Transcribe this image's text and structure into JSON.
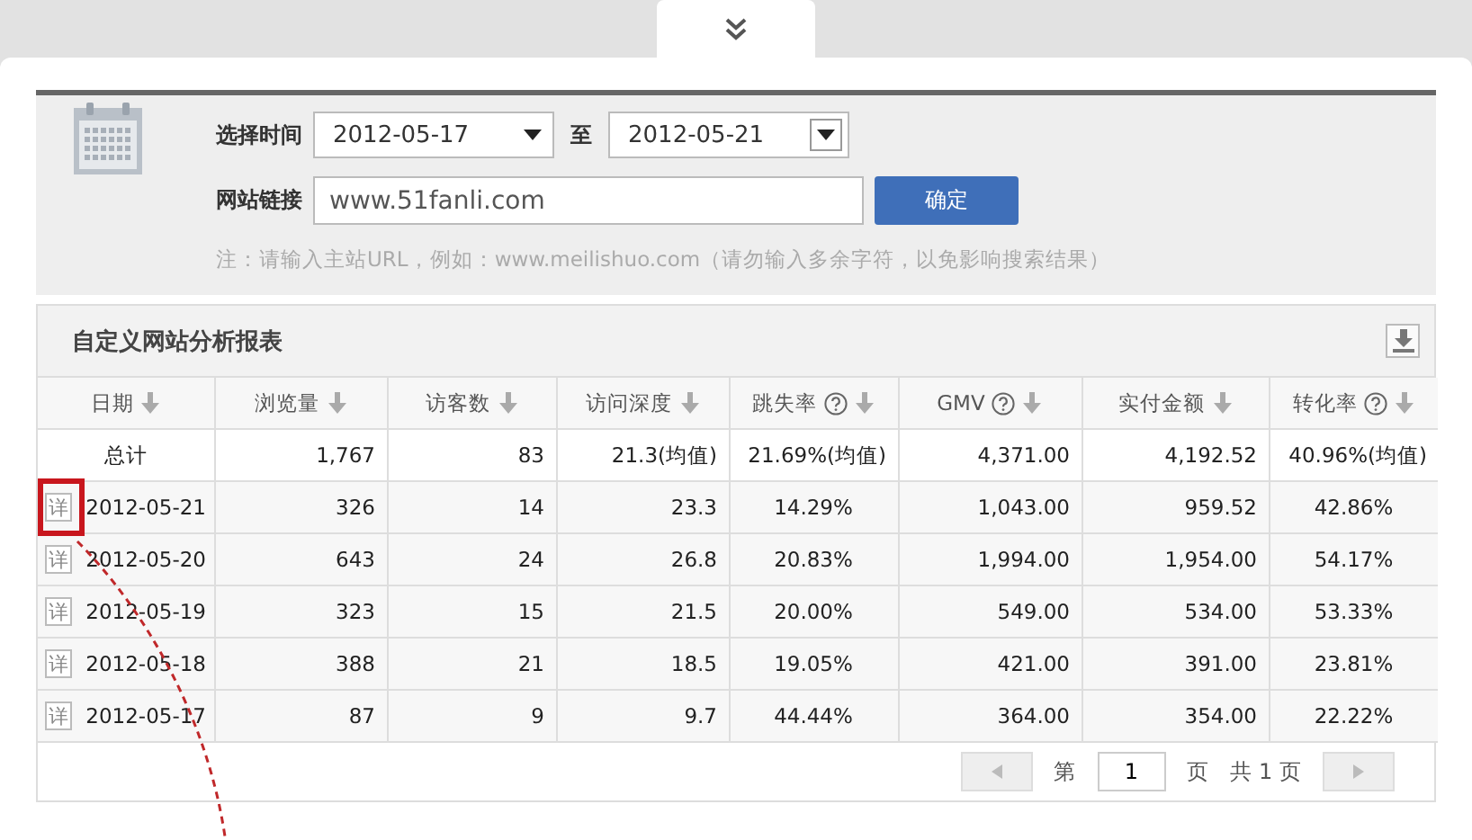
{
  "filter": {
    "time_label": "选择时间",
    "date_from": "2012-05-17",
    "separator": "至",
    "date_to": "2012-05-21",
    "url_label": "网站链接",
    "url_value": "www.51fanli.com",
    "submit": "确定",
    "note": "注：请输入主站URL，例如：www.meilishuo.com（请勿输入多余字符，以免影响搜索结果）"
  },
  "report": {
    "title": "自定义网站分析报表",
    "columns": [
      {
        "label": "日期",
        "help": false
      },
      {
        "label": "浏览量",
        "help": false
      },
      {
        "label": "访客数",
        "help": false
      },
      {
        "label": "访问深度",
        "help": false
      },
      {
        "label": "跳失率",
        "help": true
      },
      {
        "label": "GMV",
        "help": true
      },
      {
        "label": "实付金额",
        "help": false
      },
      {
        "label": "转化率",
        "help": true
      }
    ],
    "total": {
      "cells": [
        "总计",
        "1,767",
        "83",
        "21.3(均值)",
        "21.69%(均值)",
        "4,371.00",
        "4,192.52",
        "40.96%(均值)"
      ]
    },
    "rows": [
      {
        "detail": "详",
        "highlighted": true,
        "cells": [
          "2012-05-21",
          "326",
          "14",
          "23.3",
          "14.29%",
          "1,043.00",
          "959.52",
          "42.86%"
        ]
      },
      {
        "detail": "详",
        "highlighted": false,
        "cells": [
          "2012-05-20",
          "643",
          "24",
          "26.8",
          "20.83%",
          "1,994.00",
          "1,954.00",
          "54.17%"
        ]
      },
      {
        "detail": "详",
        "highlighted": false,
        "cells": [
          "2012-05-19",
          "323",
          "15",
          "21.5",
          "20.00%",
          "549.00",
          "534.00",
          "53.33%"
        ]
      },
      {
        "detail": "详",
        "highlighted": false,
        "cells": [
          "2012-05-18",
          "388",
          "21",
          "18.5",
          "19.05%",
          "421.00",
          "391.00",
          "23.81%"
        ]
      },
      {
        "detail": "详",
        "highlighted": false,
        "cells": [
          "2012-05-17",
          "87",
          "9",
          "9.7",
          "44.44%",
          "364.00",
          "354.00",
          "22.22%"
        ]
      }
    ],
    "pager": {
      "prefix": "第",
      "page": "1",
      "page_suffix": "页",
      "total": "共 1 页"
    }
  }
}
